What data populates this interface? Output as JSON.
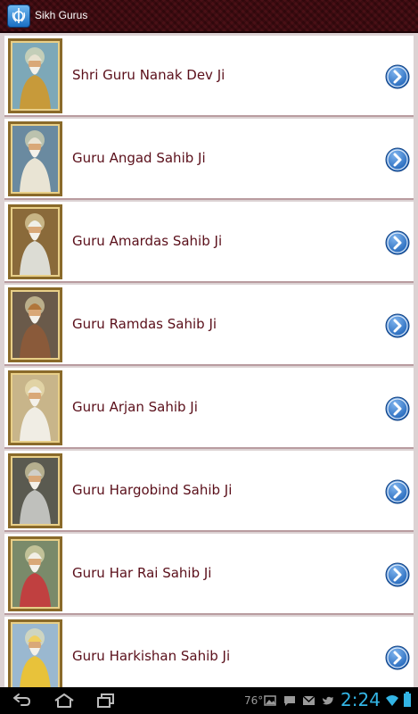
{
  "app": {
    "title": "Sikh Gurus",
    "icon": "khanda-icon"
  },
  "gurus": [
    {
      "name": "Shri Guru Nanak Dev Ji",
      "robe": "#c79a3a",
      "turban": "#e8e2d0",
      "bg": "#7da8b8"
    },
    {
      "name": "Guru Angad Sahib Ji",
      "robe": "#e9e4d4",
      "turban": "#e9e4d4",
      "bg": "#6a8aa0"
    },
    {
      "name": "Guru Amardas Sahib Ji",
      "robe": "#dcdcd4",
      "turban": "#efefe8",
      "bg": "#8a6a3a"
    },
    {
      "name": "Guru Ramdas Sahib Ji",
      "robe": "#8a5a3a",
      "turban": "#b0763a",
      "bg": "#6a5a4a"
    },
    {
      "name": "Guru Arjan Sahib Ji",
      "robe": "#f0ede4",
      "turban": "#f0ede4",
      "bg": "#c8b58a"
    },
    {
      "name": "Guru Hargobind Sahib Ji",
      "robe": "#bfc0bc",
      "turban": "#d0cfc8",
      "bg": "#5a5a50"
    },
    {
      "name": "Guru Har Rai Sahib Ji",
      "robe": "#c04040",
      "turban": "#f2efe6",
      "bg": "#7a8a6a"
    },
    {
      "name": "Guru Harkishan Sahib Ji",
      "robe": "#e8c23a",
      "turban": "#f0d060",
      "bg": "#9ab8d0"
    }
  ],
  "status": {
    "temperature": "76°",
    "time": "2:24",
    "icons": [
      "image-icon",
      "chat-icon",
      "gmail-icon",
      "twitter-icon",
      "wifi-icon",
      "battery-icon"
    ]
  },
  "nav": {
    "icons": [
      "back-icon",
      "home-icon",
      "recent-apps-icon"
    ]
  },
  "colors": {
    "label": "#5a0f1a",
    "accent": "#33b5e5",
    "arrow": "#1e63b8"
  }
}
